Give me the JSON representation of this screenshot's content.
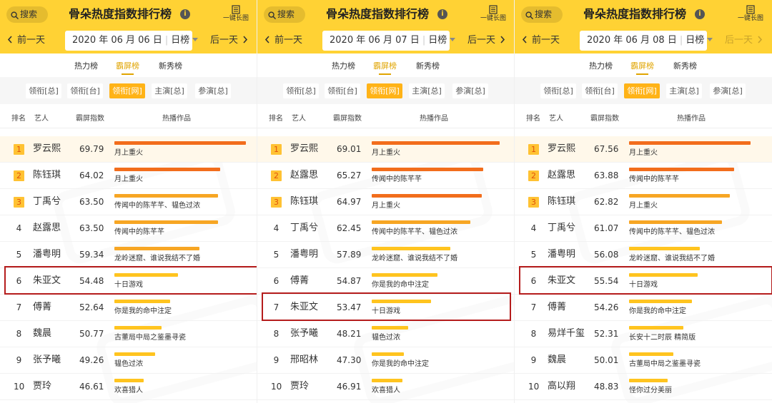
{
  "icons": {
    "search": "search-icon",
    "info": "info-icon",
    "long_image": "long-image-icon",
    "prev": "chevron-left-icon",
    "next": "chevron-right-icon",
    "date_caret": "caret-down-icon"
  },
  "colors": {
    "header": "#ffd234",
    "accent": "#ffb317",
    "active_tab": "#e0a400",
    "bar_high": "#f26d1c",
    "bar_mid": "#f7a624",
    "bar_low": "#ffc41f",
    "highlight_box": "#b51c1c"
  },
  "panels": [
    {
      "search_label": "搜索",
      "title": "骨朵热度指数排行榜",
      "long_image_label": "一键长图",
      "prev_label": "前一天",
      "next_label": "后一天",
      "next_disabled": false,
      "date": "2020 年 06 月 06 日",
      "period": "日榜",
      "tabs": [
        "热力榜",
        "霸屏榜",
        "新秀榜"
      ],
      "active_tab": 1,
      "filters": [
        "领衔[总]",
        "领衔[台]",
        "领衔[网]",
        "主演[总]",
        "参演[总]"
      ],
      "active_filter": 2,
      "columns": {
        "rank": "排名",
        "artist": "艺人",
        "index": "霸屏指数",
        "works": "热播作品"
      },
      "highlight_row": 5,
      "rows": [
        {
          "rank": "1",
          "name": "罗云熙",
          "value": "69.79",
          "works": "月上重火"
        },
        {
          "rank": "2",
          "name": "陈钰琪",
          "value": "64.02",
          "works": "月上重火"
        },
        {
          "rank": "3",
          "name": "丁禹兮",
          "value": "63.50",
          "works": "传闻中的陈芊芊、韫色过浓"
        },
        {
          "rank": "4",
          "name": "赵露思",
          "value": "63.50",
          "works": "传闻中的陈芊芊"
        },
        {
          "rank": "5",
          "name": "潘粤明",
          "value": "59.34",
          "works": "龙岭迷窟、谁说我结不了婚"
        },
        {
          "rank": "6",
          "name": "朱亚文",
          "value": "54.48",
          "works": "十日游戏"
        },
        {
          "rank": "7",
          "name": "傅菁",
          "value": "52.64",
          "works": "你是我的命中注定"
        },
        {
          "rank": "8",
          "name": "魏晨",
          "value": "50.77",
          "works": "古董局中局之鉴墨寻瓷"
        },
        {
          "rank": "9",
          "name": "张予曦",
          "value": "49.26",
          "works": "韫色过浓"
        },
        {
          "rank": "10",
          "name": "贾玲",
          "value": "46.61",
          "works": "欢喜猎人"
        }
      ]
    },
    {
      "search_label": "搜索",
      "title": "骨朵热度指数排行榜",
      "long_image_label": "一键长图",
      "prev_label": "前一天",
      "next_label": "后一天",
      "next_disabled": false,
      "date": "2020 年 06 月 07 日",
      "period": "日榜",
      "tabs": [
        "热力榜",
        "霸屏榜",
        "新秀榜"
      ],
      "active_tab": 1,
      "filters": [
        "领衔[总]",
        "领衔[台]",
        "领衔[网]",
        "主演[总]",
        "参演[总]"
      ],
      "active_filter": 2,
      "columns": {
        "rank": "排名",
        "artist": "艺人",
        "index": "霸屏指数",
        "works": "热播作品"
      },
      "highlight_row": 6,
      "rows": [
        {
          "rank": "1",
          "name": "罗云熙",
          "value": "69.01",
          "works": "月上重火"
        },
        {
          "rank": "2",
          "name": "赵露思",
          "value": "65.27",
          "works": "传闻中的陈芊芊"
        },
        {
          "rank": "3",
          "name": "陈钰琪",
          "value": "64.97",
          "works": "月上重火"
        },
        {
          "rank": "4",
          "name": "丁禹兮",
          "value": "62.45",
          "works": "传闻中的陈芊芊、韫色过浓"
        },
        {
          "rank": "5",
          "name": "潘粤明",
          "value": "57.89",
          "works": "龙岭迷窟、谁说我结不了婚"
        },
        {
          "rank": "6",
          "name": "傅菁",
          "value": "54.87",
          "works": "你是我的命中注定"
        },
        {
          "rank": "7",
          "name": "朱亚文",
          "value": "53.47",
          "works": "十日游戏"
        },
        {
          "rank": "8",
          "name": "张予曦",
          "value": "48.21",
          "works": "韫色过浓"
        },
        {
          "rank": "9",
          "name": "邢昭林",
          "value": "47.30",
          "works": "你是我的命中注定"
        },
        {
          "rank": "10",
          "name": "贾玲",
          "value": "46.91",
          "works": "欢喜猎人"
        }
      ]
    },
    {
      "search_label": "搜索",
      "title": "骨朵热度指数排行榜",
      "long_image_label": "一键长图",
      "prev_label": "前一天",
      "next_label": "后一天",
      "next_disabled": true,
      "date": "2020 年 06 月 08 日",
      "period": "日榜",
      "tabs": [
        "热力榜",
        "霸屏榜",
        "新秀榜"
      ],
      "active_tab": 1,
      "filters": [
        "领衔[总]",
        "领衔[台]",
        "领衔[网]",
        "主演[总]",
        "参演[总]"
      ],
      "active_filter": 2,
      "columns": {
        "rank": "排名",
        "artist": "艺人",
        "index": "霸屏指数",
        "works": "热播作品"
      },
      "highlight_row": 5,
      "rows": [
        {
          "rank": "1",
          "name": "罗云熙",
          "value": "67.56",
          "works": "月上重火"
        },
        {
          "rank": "2",
          "name": "赵露思",
          "value": "63.88",
          "works": "传闻中的陈芊芊"
        },
        {
          "rank": "3",
          "name": "陈钰琪",
          "value": "62.82",
          "works": "月上重火"
        },
        {
          "rank": "4",
          "name": "丁禹兮",
          "value": "61.07",
          "works": "传闻中的陈芊芊、韫色过浓"
        },
        {
          "rank": "5",
          "name": "潘粤明",
          "value": "56.08",
          "works": "龙岭迷窟、谁说我结不了婚"
        },
        {
          "rank": "6",
          "name": "朱亚文",
          "value": "55.54",
          "works": "十日游戏"
        },
        {
          "rank": "7",
          "name": "傅菁",
          "value": "54.26",
          "works": "你是我的命中注定"
        },
        {
          "rank": "8",
          "name": "易烊千玺",
          "value": "52.31",
          "works": "长安十二时辰 精简版"
        },
        {
          "rank": "9",
          "name": "魏晨",
          "value": "50.01",
          "works": "古董局中局之鉴墨寻瓷"
        },
        {
          "rank": "10",
          "name": "高以翔",
          "value": "48.83",
          "works": "怪你过分美丽"
        }
      ]
    }
  ]
}
